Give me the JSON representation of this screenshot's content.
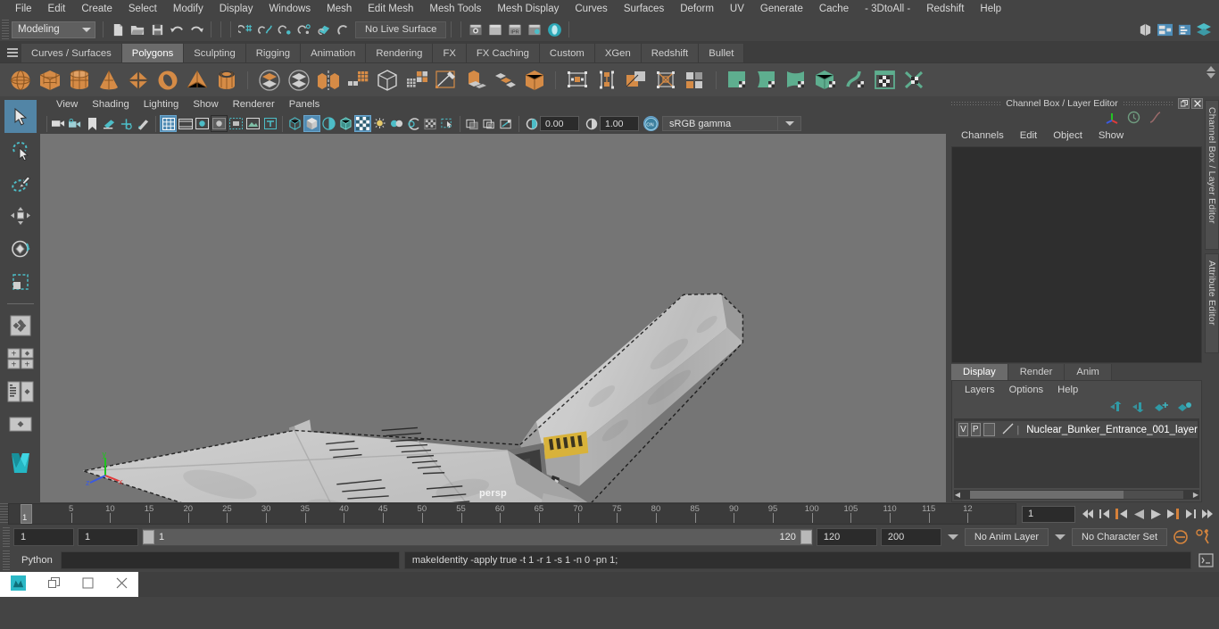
{
  "menubar": {
    "items": [
      "File",
      "Edit",
      "Create",
      "Select",
      "Modify",
      "Display",
      "Windows",
      "Mesh",
      "Edit Mesh",
      "Mesh Tools",
      "Mesh Display",
      "Curves",
      "Surfaces",
      "Deform",
      "UV",
      "Generate",
      "Cache",
      "- 3DtoAll -",
      "Redshift",
      "Help"
    ]
  },
  "statusline": {
    "menuset": "Modeling",
    "no_live_surface": "No Live Surface",
    "icons": [
      "new-scene-icon",
      "open-scene-icon",
      "save-scene-icon",
      "undo-icon",
      "redo-icon",
      "select-by-hierarchy-icon",
      "select-by-object-icon",
      "select-by-component-icon",
      "snap-to-grid-icon",
      "snap-to-curve-icon",
      "snap-to-point-icon",
      "snap-to-projected-center-icon",
      "snap-to-view-plane-icon",
      "make-live-icon",
      "render-current-frame-icon",
      "ipr-render-icon",
      "render-settings-icon",
      "hypershade-icon",
      "toggle-render-view-icon",
      "outliner-icon",
      "node-editor-icon",
      "attribute-editor-icon",
      "channel-box-icon"
    ]
  },
  "shelf": {
    "tabs": [
      "Curves / Surfaces",
      "Polygons",
      "Sculpting",
      "Rigging",
      "Animation",
      "Rendering",
      "FX",
      "FX Caching",
      "Custom",
      "XGen",
      "Redshift",
      "Bullet"
    ],
    "active_tab": "Polygons",
    "icons": [
      "poly-sphere-icon",
      "poly-cube-icon",
      "poly-cylinder-icon",
      "poly-cone-icon",
      "poly-plane-icon",
      "poly-torus-icon",
      "poly-pyramid-icon",
      "poly-pipe-icon",
      "combine-icon",
      "separate-icon",
      "mirror-geometry-icon",
      "smooth-icon",
      "boolean-icon",
      "quad-draw-icon",
      "extrude-icon",
      "multi-cut-icon",
      "bevel-icon",
      "bridge-icon",
      "target-weld-icon",
      "insert-edge-loop-icon",
      "offset-edge-loop-icon",
      "connect-components-icon",
      "detach-components-icon",
      "uv-planar-icon",
      "uv-cylindrical-icon",
      "uv-spherical-icon",
      "uv-automatic-icon",
      "uv-unfold-icon",
      "uv-editor-icon",
      "uv-cut-sew-icon"
    ]
  },
  "toolbox": {
    "items": [
      "select-tool-icon",
      "lasso-select-tool-icon",
      "paint-select-tool-icon",
      "move-tool-icon",
      "rotate-tool-icon",
      "scale-tool-icon",
      "last-tool-icon",
      "four-view-layout-icon",
      "persp-outliner-layout-icon",
      "persp-graph-layout-icon",
      "single-perspective-layout-icon",
      "maya-logo-icon"
    ],
    "selected": "select-tool-icon"
  },
  "viewport": {
    "menus": [
      "View",
      "Shading",
      "Lighting",
      "Show",
      "Renderer",
      "Panels"
    ],
    "camera_label": "persp",
    "exposure": "0.00",
    "gamma": "1.00",
    "color_space": "sRGB gamma",
    "toolbar_icons": [
      "select-camera-icon",
      "camera-attributes-icon",
      "bookmark-icon",
      "image-plane-icon",
      "two-d-pan-zoom-icon",
      "grease-pencil-icon",
      "grid-icon",
      "film-gate-icon",
      "resolution-gate-icon",
      "gate-mask-icon",
      "film-origin-icon",
      "exposure-icon",
      "xray-joints-icon",
      "wireframe-icon",
      "smooth-shade-icon",
      "shaded-wireframe-icon",
      "textured-icon",
      "use-default-lighting-icon",
      "shadows-icon",
      "screen-space-ao-icon",
      "motion-blur-icon",
      "multisample-icon",
      "depth-of-field-icon",
      "isolate-select-icon",
      "xray-icon",
      "xray-active-icon",
      "xray-joints-toggle-icon",
      "exposure-field-icon",
      "gamma-field-icon",
      "color-management-icon"
    ],
    "axis_labels": {
      "x": "x",
      "y": "y",
      "z": "z"
    }
  },
  "channel_box": {
    "title": "Channel Box / Layer Editor",
    "menus": [
      "Channels",
      "Edit",
      "Object",
      "Show"
    ],
    "header_icons": [
      "axis-gizmo-icon",
      "clock-icon",
      "curve-icon"
    ],
    "window_buttons": [
      "undock-icon",
      "close-icon"
    ]
  },
  "layer_editor": {
    "tabs": [
      "Display",
      "Render",
      "Anim"
    ],
    "active_tab": "Display",
    "menus": [
      "Layers",
      "Options",
      "Help"
    ],
    "buttons": [
      "move-layer-up-icon",
      "move-layer-down-icon",
      "create-new-layer-icon",
      "create-layer-from-selected-icon"
    ],
    "layers": [
      {
        "visibility": "V",
        "playback": "P",
        "shading": "",
        "name": "Nuclear_Bunker_Entrance_001_layer"
      }
    ]
  },
  "right_vtabs": [
    "Channel Box / Layer Editor",
    "Attribute Editor"
  ],
  "timeline": {
    "tick_labels": [
      "5",
      "10",
      "15",
      "20",
      "25",
      "30",
      "35",
      "40",
      "45",
      "50",
      "55",
      "60",
      "65",
      "70",
      "75",
      "80",
      "85",
      "90",
      "95",
      "100",
      "105",
      "110",
      "115",
      "12"
    ],
    "current_frame_marker": "1",
    "current_frame_field": "1",
    "transport_buttons": [
      "go-to-start-icon",
      "step-back-keyframe-icon",
      "step-back-frame-icon",
      "play-backwards-icon",
      "play-forwards-icon",
      "step-forward-frame-icon",
      "step-forward-keyframe-icon",
      "go-to-end-icon"
    ]
  },
  "range": {
    "anim_start": "1",
    "range_start": "1",
    "slider_min_label": "1",
    "slider_max_label": "120",
    "range_end": "120",
    "anim_end": "200",
    "anim_layer": "No Anim Layer",
    "character_set": "No Character Set",
    "icons": [
      "auto-keyframe-icon",
      "animation-preferences-icon"
    ]
  },
  "command_line": {
    "language_label": "Python",
    "input_value": "",
    "output_text": "makeIdentity -apply true -t 1 -r 1 -s 1 -n 0 -pn 1;",
    "script_editor_icon": "script-editor-icon"
  },
  "taskbar": {
    "buttons": [
      "app-thumbnail-icon",
      "restore-window-icon",
      "maximize-window-icon",
      "close-window-icon"
    ]
  },
  "colors": {
    "accent_teal": "#4da8b5",
    "accent_orange": "#d8883f",
    "selection_blue": "#5285a6",
    "panel_bg": "#444444",
    "viewport_bg": "#757575"
  }
}
